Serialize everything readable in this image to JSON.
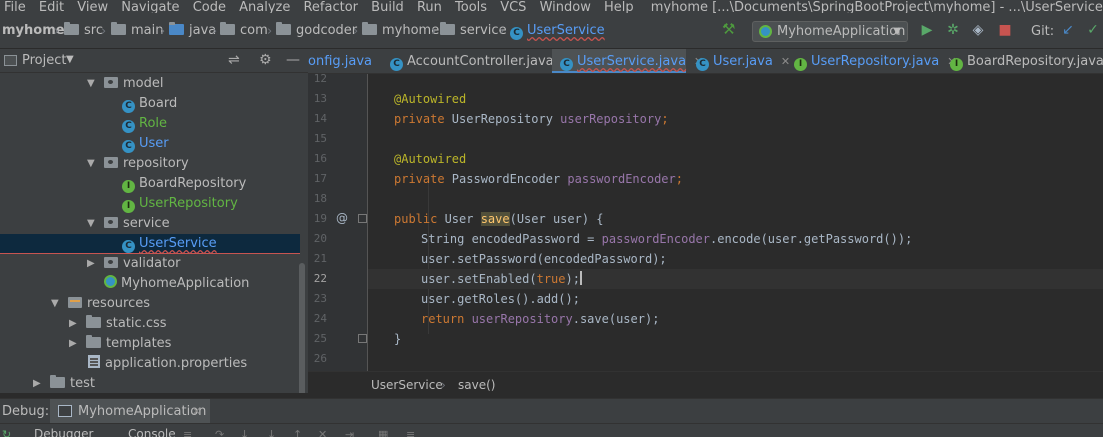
{
  "menu": {
    "items": [
      "File",
      "Edit",
      "View",
      "Navigate",
      "Code",
      "Analyze",
      "Refactor",
      "Build",
      "Run",
      "Tools",
      "VCS",
      "Window",
      "Help"
    ],
    "window_title": "myhome [...\\Documents\\SpringBootProject\\myhome] - ...\\UserService.java"
  },
  "nav": {
    "project": "myhome",
    "crumbs": [
      "src",
      "main",
      "java",
      "com",
      "godcoder",
      "myhome",
      "service"
    ],
    "current_file": "UserService",
    "run_config": "MyhomeApplication",
    "git_label": "Git:"
  },
  "project_panel": {
    "title": "Project",
    "tree": [
      {
        "label": "model",
        "icon": "package-icon"
      },
      {
        "label": "Board",
        "icon": "class-icon"
      },
      {
        "label": "Role",
        "icon": "class-icon"
      },
      {
        "label": "User",
        "icon": "class-icon"
      },
      {
        "label": "repository",
        "icon": "package-icon"
      },
      {
        "label": "BoardRepository",
        "icon": "interface-icon"
      },
      {
        "label": "UserRepository",
        "icon": "interface-icon"
      },
      {
        "label": "service",
        "icon": "package-icon"
      },
      {
        "label": "UserService",
        "icon": "class-icon"
      },
      {
        "label": "validator",
        "icon": "package-icon"
      },
      {
        "label": "MyhomeApplication",
        "icon": "spring-class-icon"
      },
      {
        "label": "resources",
        "icon": "resources-folder-icon"
      },
      {
        "label": "static.css",
        "icon": "folder-icon"
      },
      {
        "label": "templates",
        "icon": "folder-icon"
      },
      {
        "label": "application.properties",
        "icon": "properties-file-icon"
      },
      {
        "label": "test",
        "icon": "folder-icon"
      }
    ]
  },
  "tabs": [
    {
      "label": "onfig.java"
    },
    {
      "label": "AccountController.java"
    },
    {
      "label": "UserService.java"
    },
    {
      "label": "User.java"
    },
    {
      "label": "UserRepository.java"
    },
    {
      "label": "BoardRepository.java"
    }
  ],
  "editor": {
    "current_line": "22",
    "lines": [
      {
        "n": "12",
        "text": ""
      },
      {
        "n": "13",
        "text": "@Autowired"
      },
      {
        "n": "14",
        "kw": "private ",
        "type": "UserRepository ",
        "field": "userRepository",
        "rest": ";"
      },
      {
        "n": "15",
        "text": ""
      },
      {
        "n": "16",
        "text": "@Autowired"
      },
      {
        "n": "17",
        "kw": "private ",
        "type": "PasswordEncoder ",
        "field": "passwordEncoder",
        "rest": ";"
      },
      {
        "n": "18",
        "text": ""
      },
      {
        "n": "19",
        "kw": "public ",
        "type": "User ",
        "method": "save",
        "rest": "(User user) {"
      },
      {
        "n": "20",
        "type": "String encodedPassword = ",
        "field": "passwordEncoder",
        "rest": ".encode(user.getPassword());"
      },
      {
        "n": "21",
        "text": "user.setPassword(encodedPassword);"
      },
      {
        "n": "22",
        "type": "user.setEnabled(",
        "kw": "true",
        "rest": ");"
      },
      {
        "n": "23",
        "text": "user.getRoles().add();"
      },
      {
        "n": "24",
        "kw": "return ",
        "field": "userRepository",
        "rest": ".save(user);"
      },
      {
        "n": "25",
        "text": "}"
      },
      {
        "n": "26",
        "text": ""
      }
    ],
    "gutter_mark": "@"
  },
  "breadcrumb": {
    "class": "UserService",
    "method": "save()"
  },
  "debug": {
    "label": "Debug:",
    "tab": "MyhomeApplication",
    "subtabs": [
      "Debugger",
      "Console"
    ]
  }
}
